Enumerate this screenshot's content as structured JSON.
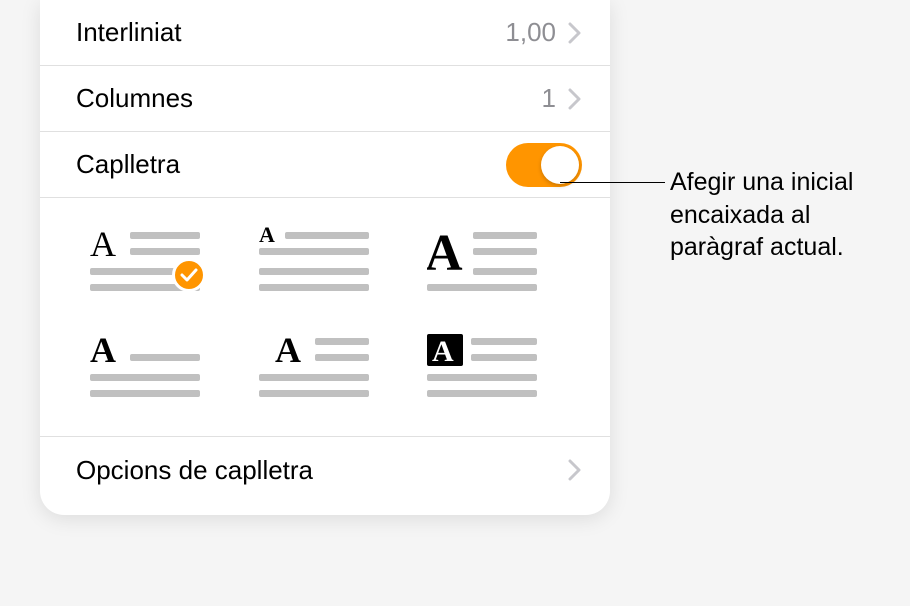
{
  "rows": {
    "interliniat": {
      "label": "Interliniat",
      "value": "1,00"
    },
    "columnes": {
      "label": "Columnes",
      "value": "1"
    },
    "caplletra": {
      "label": "Caplletra",
      "enabled": true
    },
    "opcions": {
      "label": "Opcions de caplletra"
    }
  },
  "callout": {
    "text": "Afegir una inicial encaixada al paràgraf actual."
  }
}
